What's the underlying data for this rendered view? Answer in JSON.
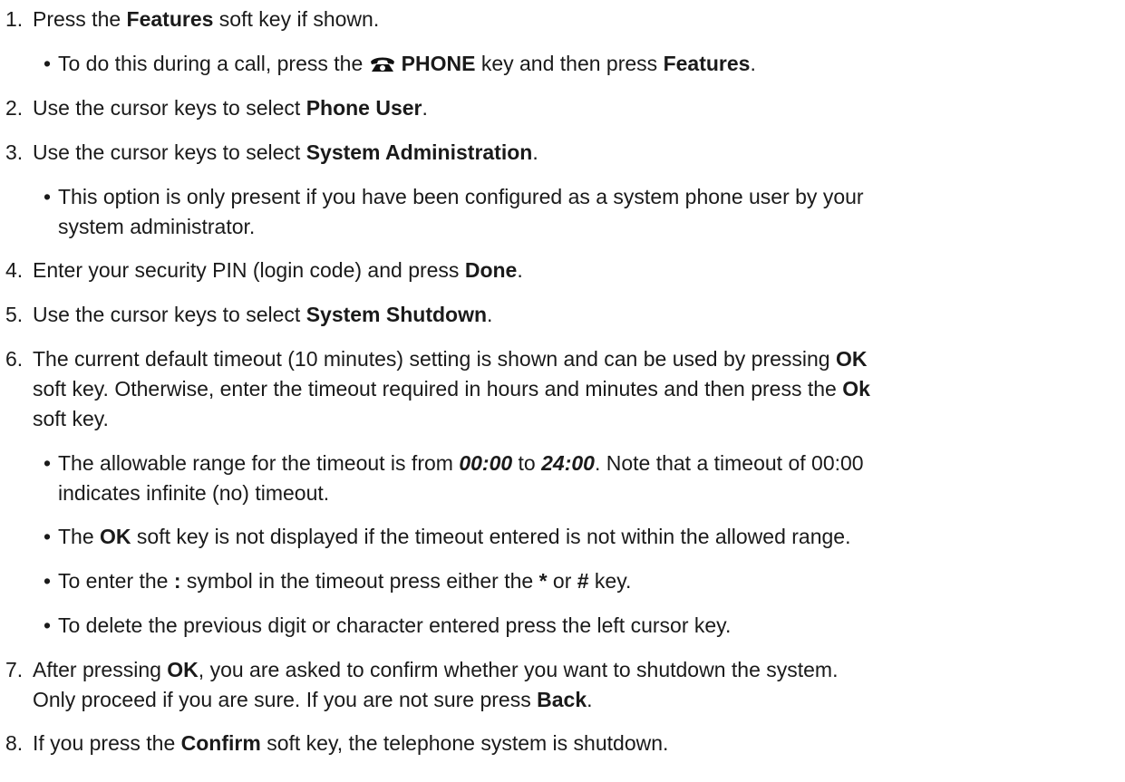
{
  "steps": [
    {
      "num": "1.",
      "parts": [
        {
          "t": "Press the "
        },
        {
          "t": "Features",
          "b": true
        },
        {
          "t": " soft key if shown."
        }
      ]
    },
    {
      "num": "2.",
      "parts": [
        {
          "t": "Use the cursor keys to select "
        },
        {
          "t": "Phone User",
          "b": true
        },
        {
          "t": "."
        }
      ]
    },
    {
      "num": "3.",
      "parts": [
        {
          "t": "Use the cursor keys to select "
        },
        {
          "t": "System Administration",
          "b": true
        },
        {
          "t": "."
        }
      ]
    },
    {
      "num": "4.",
      "parts": [
        {
          "t": "Enter your security PIN (login code) and press "
        },
        {
          "t": "Done",
          "b": true
        },
        {
          "t": "."
        }
      ]
    },
    {
      "num": "5.",
      "parts": [
        {
          "t": "Use the cursor keys to select "
        },
        {
          "t": "System Shutdown",
          "b": true
        },
        {
          "t": "."
        }
      ]
    },
    {
      "num": "6.",
      "parts": [
        {
          "t": "The current default timeout (10 minutes) setting is shown and can be used by pressing "
        },
        {
          "t": "OK",
          "b": true
        },
        {
          "t": "br"
        },
        {
          "t": "soft key. Otherwise, enter the timeout required in hours and minutes and then press the "
        },
        {
          "t": "Ok",
          "b": true
        },
        {
          "t": "br"
        },
        {
          "t": "soft key."
        }
      ]
    },
    {
      "num": "7.",
      "parts": [
        {
          "t": "After pressing "
        },
        {
          "t": "OK",
          "b": true
        },
        {
          "t": ", you are asked to confirm whether you want to shutdown the system."
        },
        {
          "t": "br"
        },
        {
          "t": "Only proceed if you are sure. If you are not sure press "
        },
        {
          "t": "Back",
          "b": true
        },
        {
          "t": "."
        }
      ]
    },
    {
      "num": "8.",
      "parts": [
        {
          "t": "If you press the "
        },
        {
          "t": "Confirm",
          "b": true
        },
        {
          "t": " soft key, the telephone system is shutdown."
        }
      ]
    }
  ],
  "bullets": [
    {
      "bullet": "•",
      "parts": [
        {
          "t": "To do this during a call, press the "
        },
        {
          "icon": "telephone-icon"
        },
        {
          "t": "PHONE",
          "b": true
        },
        {
          "t": " key and then press "
        },
        {
          "t": "Features",
          "b": true
        },
        {
          "t": "."
        }
      ]
    },
    {
      "bullet": "•",
      "parts": [
        {
          "t": "This option is only present if you have been configured as a system phone user by your"
        },
        {
          "t": "br"
        },
        {
          "t": "system administrator."
        }
      ]
    },
    {
      "bullet": "•",
      "parts": [
        {
          "t": "The allowable range for the timeout is from "
        },
        {
          "t": "00:00",
          "b": true,
          "i": true
        },
        {
          "t": " to "
        },
        {
          "t": "24:00",
          "b": true,
          "i": true
        },
        {
          "t": ". Note that a timeout of 00:00"
        },
        {
          "t": "br"
        },
        {
          "t": "indicates infinite (no) timeout."
        }
      ]
    },
    {
      "bullet": "•",
      "parts": [
        {
          "t": "The "
        },
        {
          "t": "OK",
          "b": true
        },
        {
          "t": " soft key is not displayed if the timeout entered is not within the allowed range."
        }
      ]
    },
    {
      "bullet": "•",
      "parts": [
        {
          "t": "To enter the "
        },
        {
          "t": ":",
          "b": true
        },
        {
          "t": " symbol in the timeout press either the "
        },
        {
          "t": "*",
          "b": true
        },
        {
          "t": " or "
        },
        {
          "t": "#",
          "b": true
        },
        {
          "t": " key."
        }
      ]
    },
    {
      "bullet": "•",
      "parts": [
        {
          "t": "To delete the previous digit or character entered press the left cursor key."
        }
      ]
    }
  ]
}
